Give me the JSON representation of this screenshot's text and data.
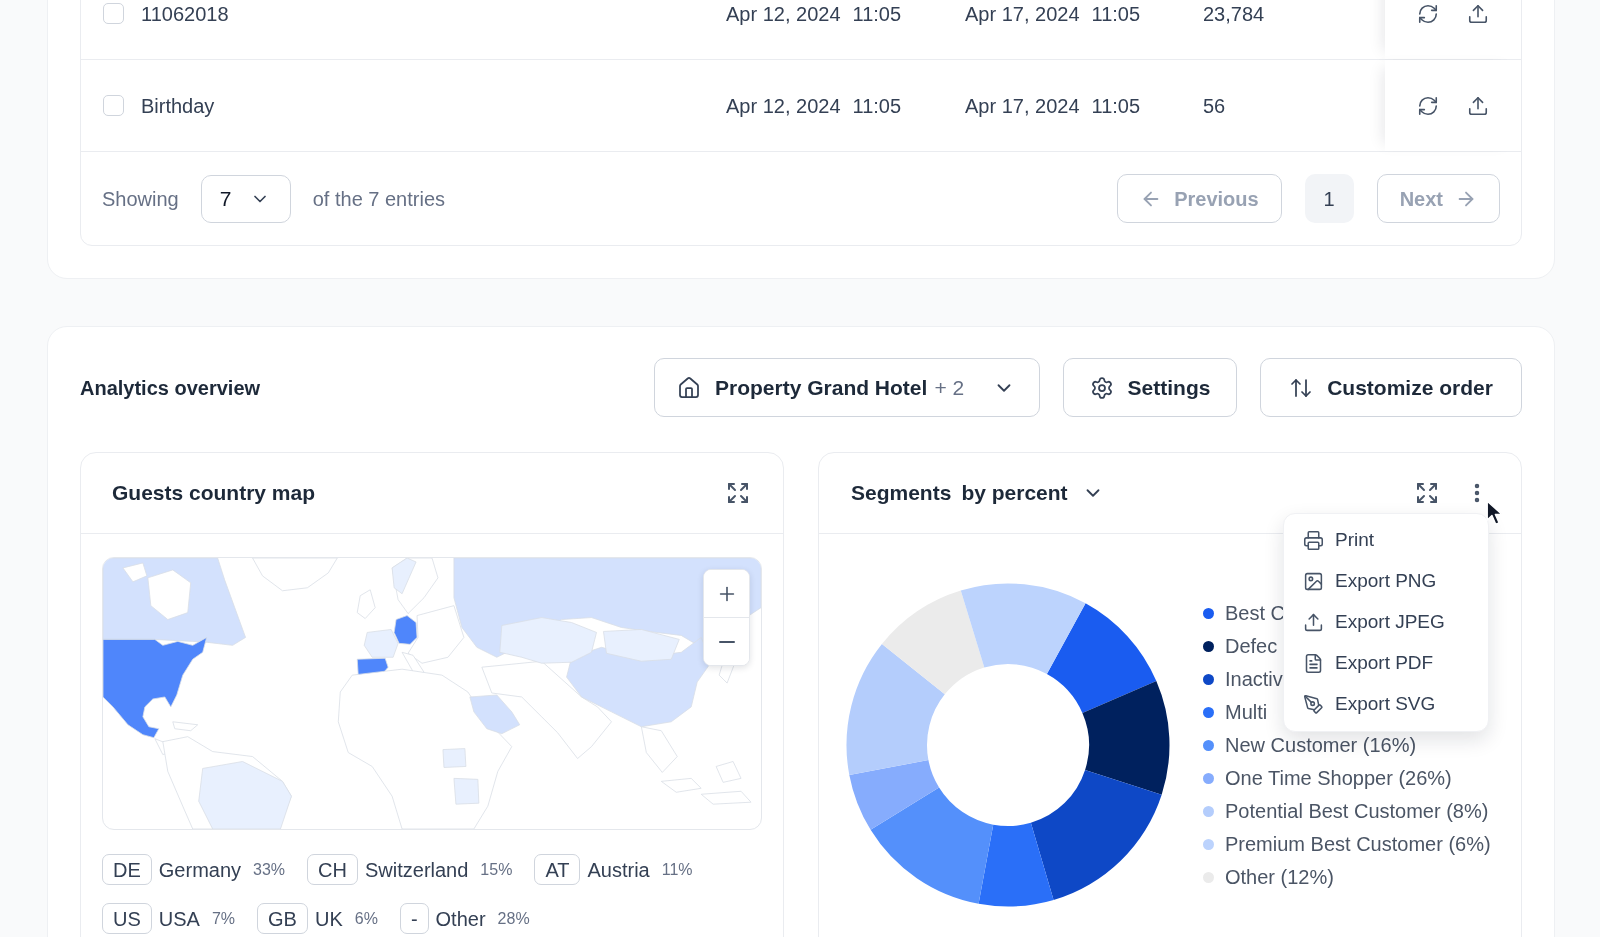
{
  "table": {
    "rows": [
      {
        "checked": false,
        "name": "11062018",
        "start_date": "Apr 12, 2024",
        "start_time": "11:05",
        "end_date": "Apr 17, 2024",
        "end_time": "11:05",
        "count": "23,784"
      },
      {
        "checked": false,
        "name": "Birthday",
        "start_date": "Apr 12, 2024",
        "start_time": "11:05",
        "end_date": "Apr 17, 2024",
        "end_time": "11:05",
        "count": "56"
      }
    ]
  },
  "pagination": {
    "showing_label": "Showing",
    "page_size": "7",
    "entries_label": "of the 7 entries",
    "previous": {
      "label": "Previous",
      "disabled": true
    },
    "pages": [
      {
        "label": "1",
        "selected": true
      }
    ],
    "next": {
      "label": "Next",
      "disabled": true
    }
  },
  "analytics": {
    "title": "Analytics overview",
    "property_filter": {
      "label": "Property Grand Hotel",
      "extra": "+ 2"
    },
    "actions": [
      {
        "kind": "settings",
        "label": "Settings"
      },
      {
        "kind": "order",
        "label": "Customize order"
      }
    ]
  },
  "map_card": {
    "title": "Guests country map",
    "countries": [
      {
        "code": "DE",
        "name": "Germany",
        "share": "33%"
      },
      {
        "code": "CH",
        "name": "Switzerland",
        "share": "15%"
      },
      {
        "code": "AT",
        "name": "Austria",
        "share": "11%"
      },
      {
        "code": "US",
        "name": "USA",
        "share": "7%"
      },
      {
        "code": "GB",
        "name": "UK",
        "share": "6%"
      },
      {
        "code": "-",
        "name": "Other",
        "share": "28%"
      }
    ]
  },
  "segments_card": {
    "title": "Segments",
    "metric": "by percent",
    "legend": [
      {
        "label": "Best C",
        "color": "#1a5cf0"
      },
      {
        "label": "Defec",
        "color": "#00215e"
      },
      {
        "label": "Inactiv",
        "color": "#0e48c6"
      },
      {
        "label": "Multi",
        "color": "#2a6ff8"
      },
      {
        "label": "New Customer (16%)",
        "color": "#5490fb"
      },
      {
        "label": "One Time Shopper (26%)",
        "color": "#86acfd"
      },
      {
        "label": "Potential Best Customer (8%)",
        "color": "#b4cdfc"
      },
      {
        "label": "Premium Best Customer (6%)",
        "color": "#bcd3fd"
      },
      {
        "label": "Other (12%)",
        "color": "#ebebeb"
      }
    ],
    "menu": {
      "items": [
        {
          "kind": "print",
          "label": "Print"
        },
        {
          "kind": "png",
          "label": "Export PNG"
        },
        {
          "kind": "jpeg",
          "label": "Export JPEG"
        },
        {
          "kind": "pdf",
          "label": "Export PDF"
        },
        {
          "kind": "svg",
          "label": "Export SVG"
        }
      ]
    }
  }
}
